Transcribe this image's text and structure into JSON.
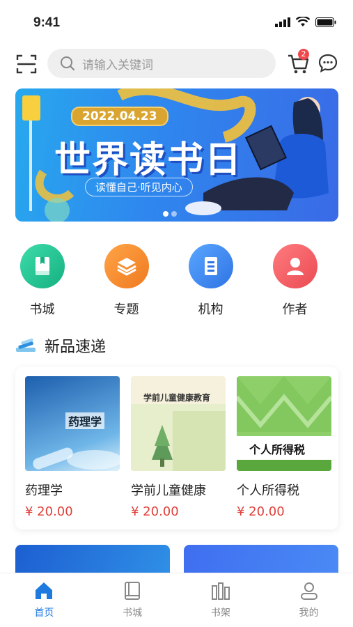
{
  "status_bar": {
    "time": "9:41"
  },
  "search": {
    "placeholder": "请输入关键词",
    "cart_badge": "2"
  },
  "banner": {
    "date": "2022.04.23",
    "title": "世界读书日",
    "subtitle": "读懂自己·听见内心",
    "slides": 2,
    "active_slide": 0
  },
  "categories": [
    {
      "label": "书城",
      "color": "#21c08f",
      "icon": "book-icon"
    },
    {
      "label": "专题",
      "color": "#f68a2b",
      "icon": "layers-icon"
    },
    {
      "label": "机构",
      "color": "#3d8ef2",
      "icon": "building-icon"
    },
    {
      "label": "作者",
      "color": "#f25a5f",
      "icon": "user-icon"
    }
  ],
  "new_products": {
    "title": "新品速递",
    "items": [
      {
        "name": "药理学",
        "price": "¥ 20.00",
        "cover_text": "药理学"
      },
      {
        "name": "学前儿童健康",
        "price": "¥ 20.00",
        "cover_text": "学前儿童健康教育"
      },
      {
        "name": "个人所得税",
        "price": "¥ 20.00",
        "cover_text": "个人所得税"
      }
    ]
  },
  "tabbar": [
    {
      "label": "首页",
      "icon": "home-icon",
      "active": true
    },
    {
      "label": "书城",
      "icon": "book-icon",
      "active": false
    },
    {
      "label": "书架",
      "icon": "bookshelf-icon",
      "active": false
    },
    {
      "label": "我的",
      "icon": "user-icon",
      "active": false
    }
  ],
  "colors": {
    "accent": "#1f7ae0",
    "price": "#e0403a",
    "badge": "#f0474d"
  }
}
